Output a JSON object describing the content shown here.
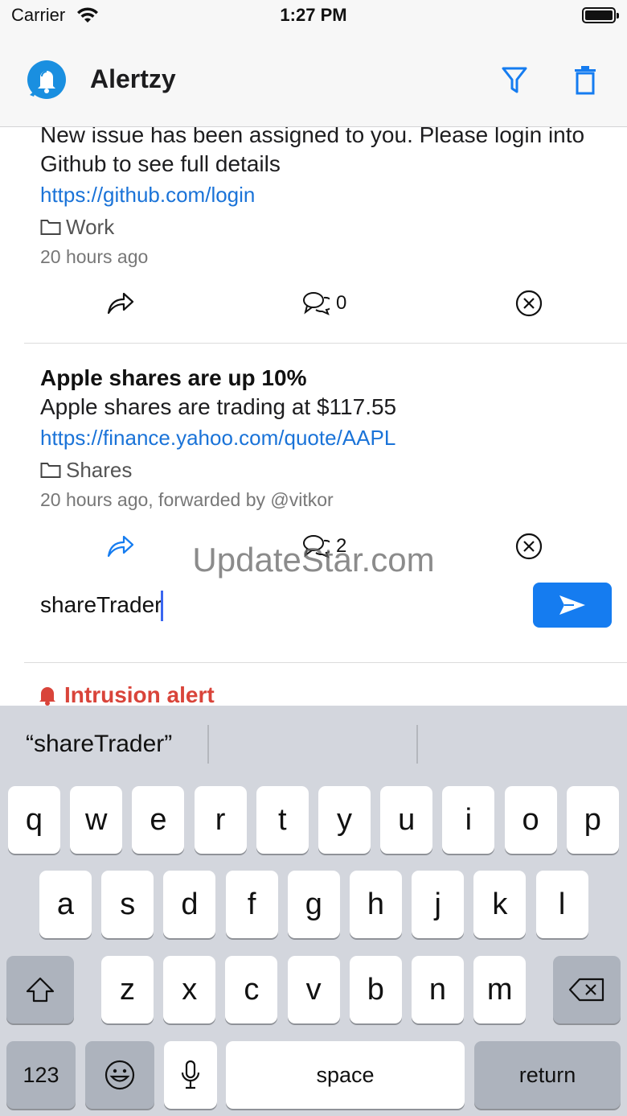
{
  "status_bar": {
    "carrier": "Carrier",
    "time": "1:27 PM"
  },
  "nav": {
    "title": "Alertzy",
    "brand_color": "#157cf0"
  },
  "alerts": [
    {
      "message": "New issue has been assigned to you. Please login into Github to see full details",
      "link": "https://github.com/login",
      "group": "Work",
      "meta": "20 hours ago",
      "comment_count": "0"
    },
    {
      "title": "Apple shares are up 10%",
      "message": "Apple shares are trading at $117.55",
      "link": "https://finance.yahoo.com/quote/AAPL",
      "group": "Shares",
      "meta": "20 hours ago, forwarded by @vitkor",
      "comment_count": "2"
    },
    {
      "title": "Intrusion alert",
      "title_color": "#d9443a"
    }
  ],
  "reply": {
    "value": "shareTrader"
  },
  "watermark": "UpdateStar.com",
  "keyboard": {
    "suggestion": "“shareTrader”",
    "row1": [
      "q",
      "w",
      "e",
      "r",
      "t",
      "y",
      "u",
      "i",
      "o",
      "p"
    ],
    "row2": [
      "a",
      "s",
      "d",
      "f",
      "g",
      "h",
      "j",
      "k",
      "l"
    ],
    "row3": [
      "z",
      "x",
      "c",
      "v",
      "b",
      "n",
      "m"
    ],
    "numbers_label": "123",
    "space_label": "space",
    "return_label": "return"
  },
  "icons": {
    "filter": "filter-icon",
    "trash": "trash-icon",
    "share": "share-icon",
    "comment": "comment-icon",
    "dismiss": "close-circle-icon",
    "folder": "folder-icon",
    "bell": "bell-icon",
    "send": "send-icon",
    "shift": "shift-icon",
    "backspace": "backspace-icon",
    "emoji": "emoji-icon",
    "mic": "microphone-icon"
  }
}
